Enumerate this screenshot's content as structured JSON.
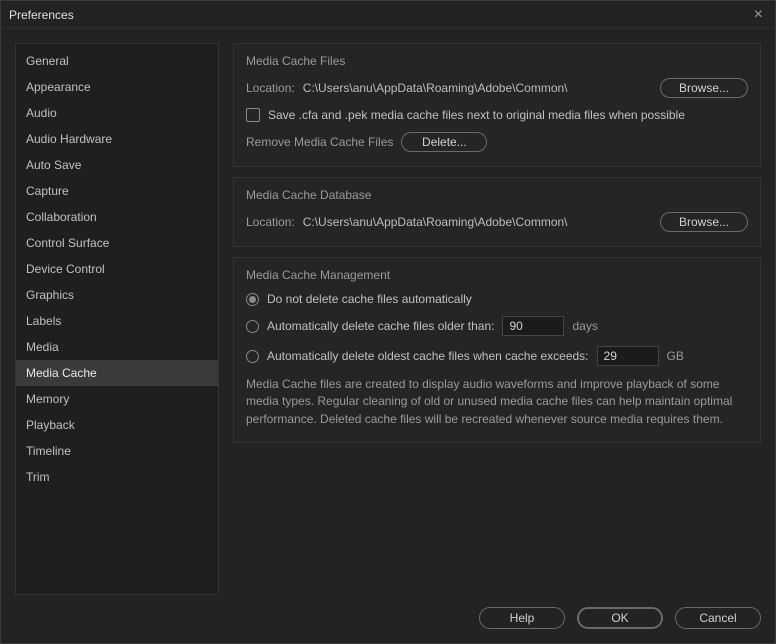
{
  "window": {
    "title": "Preferences"
  },
  "sidebar": {
    "items": [
      {
        "label": "General"
      },
      {
        "label": "Appearance"
      },
      {
        "label": "Audio"
      },
      {
        "label": "Audio Hardware"
      },
      {
        "label": "Auto Save"
      },
      {
        "label": "Capture"
      },
      {
        "label": "Collaboration"
      },
      {
        "label": "Control Surface"
      },
      {
        "label": "Device Control"
      },
      {
        "label": "Graphics"
      },
      {
        "label": "Labels"
      },
      {
        "label": "Media"
      },
      {
        "label": "Media Cache",
        "selected": true
      },
      {
        "label": "Memory"
      },
      {
        "label": "Playback"
      },
      {
        "label": "Timeline"
      },
      {
        "label": "Trim"
      }
    ]
  },
  "groups": {
    "files": {
      "title": "Media Cache Files",
      "location_label": "Location:",
      "location_path": "C:\\Users\\anu\\AppData\\Roaming\\Adobe\\Common\\",
      "browse": "Browse...",
      "checkbox_label": "Save .cfa and .pek media cache files next to original media files when possible",
      "remove_label": "Remove Media Cache Files",
      "delete": "Delete..."
    },
    "database": {
      "title": "Media Cache Database",
      "location_label": "Location:",
      "location_path": "C:\\Users\\anu\\AppData\\Roaming\\Adobe\\Common\\",
      "browse": "Browse..."
    },
    "management": {
      "title": "Media Cache Management",
      "opt_none": "Do not delete cache files automatically",
      "opt_older": "Automatically delete cache files older than:",
      "opt_older_value": "90",
      "opt_older_unit": "days",
      "opt_exceeds": "Automatically delete oldest cache files when cache exceeds:",
      "opt_exceeds_value": "29",
      "opt_exceeds_unit": "GB",
      "desc": "Media Cache files are created to display audio waveforms and improve playback of some media types.  Regular cleaning of old or unused media cache files can help maintain optimal performance. Deleted cache files will be recreated whenever source media requires them."
    }
  },
  "footer": {
    "help": "Help",
    "ok": "OK",
    "cancel": "Cancel"
  }
}
